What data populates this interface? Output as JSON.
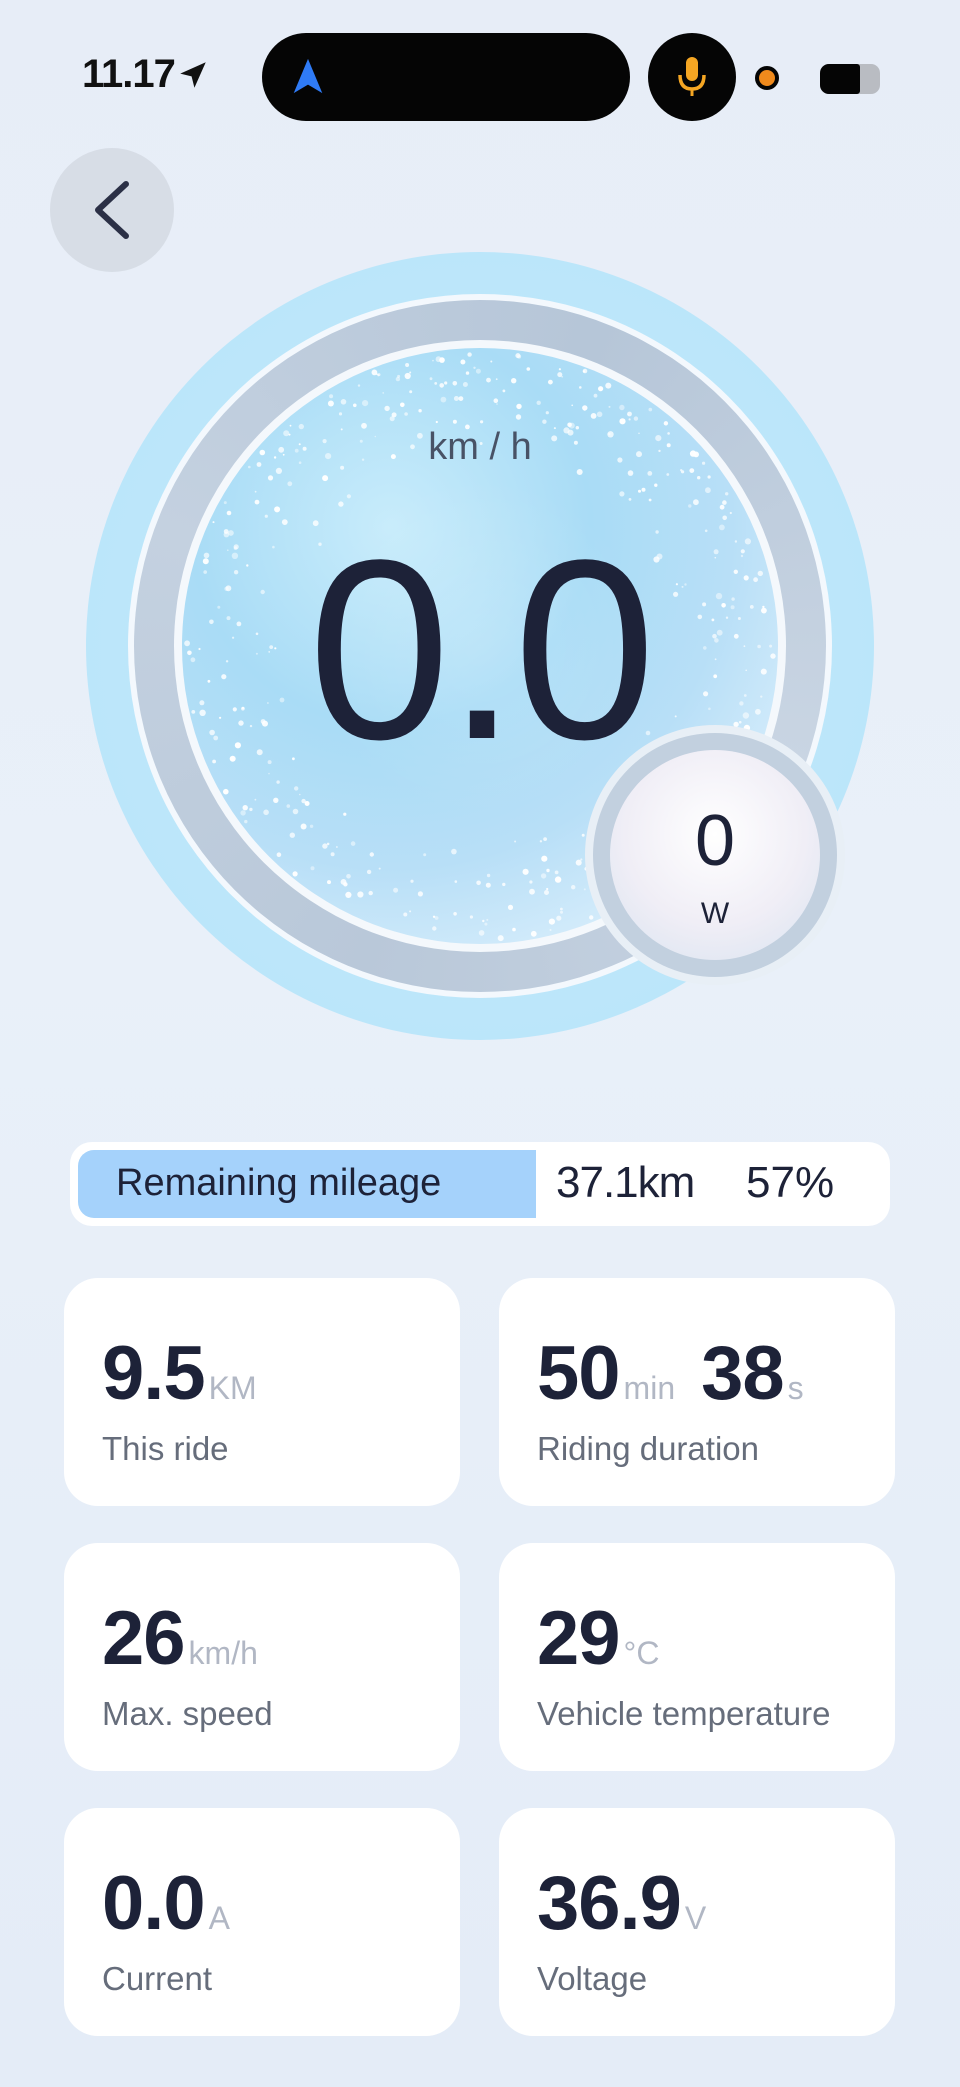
{
  "status_bar": {
    "time": "11.17",
    "icons": [
      "location-arrow-icon",
      "navigation-icon",
      "microphone-icon",
      "recording-dot-icon",
      "battery-icon"
    ],
    "colors": {
      "mic": "#f5a623",
      "recording_dot": "#f08a1c",
      "nav": "#2f7bf6"
    }
  },
  "header": {
    "back_icon": "chevron-left-icon"
  },
  "gauge": {
    "speed_unit": "km / h",
    "speed": "0.0",
    "power": "0",
    "power_unit": "W"
  },
  "mileage": {
    "label": "Remaining mileage",
    "distance": "37.1km",
    "percent_text": "57%",
    "fill_fraction": 0.57
  },
  "stats": [
    {
      "value": "9.5",
      "unit": "KM",
      "label": "This ride"
    },
    {
      "value_min": "50",
      "unit_min": "min",
      "value_sec": "38",
      "unit_sec": "s",
      "label": "Riding duration"
    },
    {
      "value": "26",
      "unit": "km/h",
      "label": "Max. speed"
    },
    {
      "value": "29",
      "unit": "°C",
      "label": "Vehicle temperature"
    },
    {
      "value": "0.0",
      "unit": "A",
      "label": "Current"
    },
    {
      "value": "36.9",
      "unit": "V",
      "label": "Voltage"
    }
  ]
}
